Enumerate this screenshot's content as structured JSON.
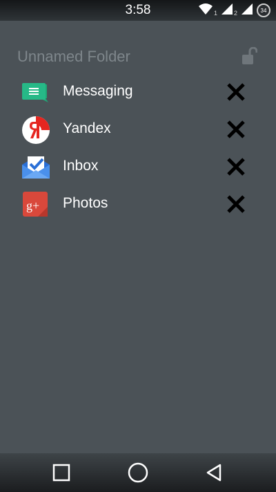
{
  "status_bar": {
    "time": "3:58",
    "sim1": "1",
    "sim2": "2",
    "battery": "34"
  },
  "folder": {
    "title": "Unnamed Folder"
  },
  "apps": [
    {
      "label": "Messaging",
      "icon": "messaging-icon"
    },
    {
      "label": "Yandex",
      "icon": "yandex-icon"
    },
    {
      "label": "Inbox",
      "icon": "inbox-icon"
    },
    {
      "label": "Photos",
      "icon": "google-plus-photos-icon"
    }
  ],
  "colors": {
    "background": "#4b5257",
    "title": "#7e868b",
    "text": "#ffffff",
    "remove": "#000000"
  }
}
